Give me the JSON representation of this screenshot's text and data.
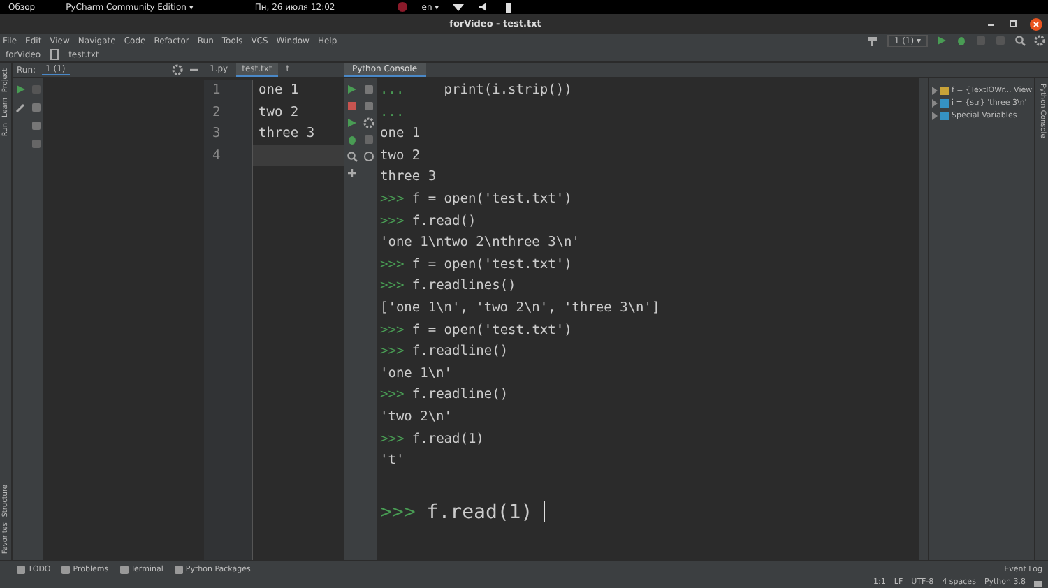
{
  "os_bar": {
    "activities": "Обзор",
    "app_menu": "PyCharm Community Edition ▾",
    "clock": "Пн, 26 июля 12:02",
    "language": "en ▾"
  },
  "window": {
    "title": "forVideo - test.txt"
  },
  "menu": [
    "File",
    "Edit",
    "View",
    "Navigate",
    "Code",
    "Refactor",
    "Run",
    "Tools",
    "VCS",
    "Window",
    "Help"
  ],
  "run_config": "1 (1) ▾",
  "breadcrumbs": [
    "forVideo",
    "test.txt"
  ],
  "left_strip": {
    "top": [
      "Project",
      "Learn",
      "Run"
    ],
    "bottom": [
      "Structure",
      "Favorites"
    ]
  },
  "run_panel": {
    "label": "Run:",
    "tab": "1 (1)"
  },
  "editor": {
    "tabs": [
      {
        "label": "1.py",
        "selected": false
      },
      {
        "label": "test.txt",
        "selected": true
      },
      {
        "label": "t",
        "selected": false
      }
    ],
    "lines": [
      {
        "number": "1",
        "text": "one 1",
        "current": false
      },
      {
        "number": "2",
        "text": "two 2",
        "current": false
      },
      {
        "number": "3",
        "text": "three 3",
        "current": false
      },
      {
        "number": "4",
        "current": true
      }
    ]
  },
  "console": {
    "tab": "Python Console",
    "lines": [
      {
        "kind": "continuation",
        "prompt": "...",
        "code": "    print(i.strip())"
      },
      {
        "kind": "continuation",
        "prompt": "..."
      },
      {
        "kind": "output",
        "text": "one 1"
      },
      {
        "kind": "output",
        "text": "two 2"
      },
      {
        "kind": "output",
        "text": "three 3"
      },
      {
        "kind": "prompt",
        "prompt": ">>>",
        "code": "f = open('test.txt')"
      },
      {
        "kind": "prompt",
        "prompt": ">>>",
        "code": "f.read()"
      },
      {
        "kind": "output",
        "text": "'one 1\\ntwo 2\\nthree 3\\n'"
      },
      {
        "kind": "prompt",
        "prompt": ">>>",
        "code": "f = open('test.txt')"
      },
      {
        "kind": "prompt",
        "prompt": ">>>",
        "code": "f.readlines()"
      },
      {
        "kind": "output",
        "text": "['one 1\\n', 'two 2\\n', 'three 3\\n']"
      },
      {
        "kind": "prompt",
        "prompt": ">>>",
        "code": "f = open('test.txt')"
      },
      {
        "kind": "prompt",
        "prompt": ">>>",
        "code": "f.readline()"
      },
      {
        "kind": "output",
        "text": "'one 1\\n'"
      },
      {
        "kind": "prompt",
        "prompt": ">>>",
        "code": "f.readline()"
      },
      {
        "kind": "output",
        "text": "'two 2\\n'"
      },
      {
        "kind": "prompt",
        "prompt": ">>>",
        "code": "f.read(1)"
      },
      {
        "kind": "output",
        "text": "'t'"
      }
    ],
    "input": {
      "prompt": ">>>",
      "value": "f.read(1)"
    }
  },
  "variables": [
    {
      "kind": "object",
      "text": "f = {TextIOWr... View"
    },
    {
      "kind": "string",
      "text": "i = {str} 'three 3\\n'"
    },
    {
      "kind": "special",
      "text": "Special Variables"
    }
  ],
  "right_strip": "Python Console",
  "bottom_tabs": [
    "TODO",
    "Problems",
    "Terminal",
    "Python Packages"
  ],
  "event_log": "Event Log",
  "status": [
    "1:1",
    "LF",
    "UTF-8",
    "4 spaces",
    "Python 3.8"
  ]
}
